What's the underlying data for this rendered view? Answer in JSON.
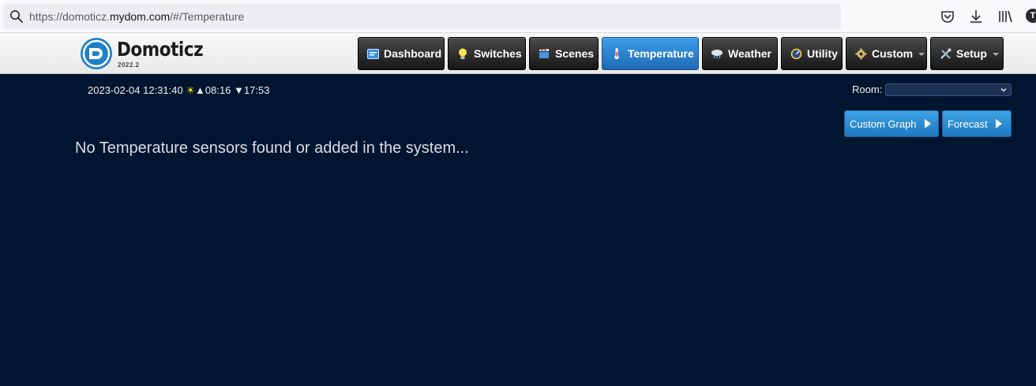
{
  "browser": {
    "url_prefix": "https://domoticz.",
    "url_host": "mydom.com",
    "url_path": "/#/Temperature",
    "profile_initial": "T"
  },
  "header": {
    "brand": "Domoticz",
    "version": "2022.2",
    "nav": [
      {
        "label": "Dashboard",
        "icon": "dashboard-icon"
      },
      {
        "label": "Switches",
        "icon": "lightbulb-icon"
      },
      {
        "label": "Scenes",
        "icon": "clapperboard-icon"
      },
      {
        "label": "Temperature",
        "icon": "thermometer-icon",
        "active": true
      },
      {
        "label": "Weather",
        "icon": "cloud-rain-icon"
      },
      {
        "label": "Utility",
        "icon": "gauge-icon"
      },
      {
        "label": "Custom",
        "icon": "gear-icon",
        "dropdown": true
      },
      {
        "label": "Setup",
        "icon": "tools-icon",
        "dropdown": true
      }
    ]
  },
  "status": {
    "datetime": "2023-02-04 12:31:40",
    "sun_symbol": "☀",
    "sunrise_symbol": "▲",
    "sunrise": "08:16",
    "sunset_symbol": "▼",
    "sunset": "17:53"
  },
  "room": {
    "label": "Room:",
    "selected": ""
  },
  "actions": {
    "custom_graph": "Custom Graph",
    "forecast": "Forecast"
  },
  "main": {
    "empty_message": "No Temperature sensors found or added in the system..."
  },
  "colors": {
    "page_bg": "#00152f",
    "active_tab": "#2a86d4",
    "nav_dark": "#1e1e1e"
  }
}
